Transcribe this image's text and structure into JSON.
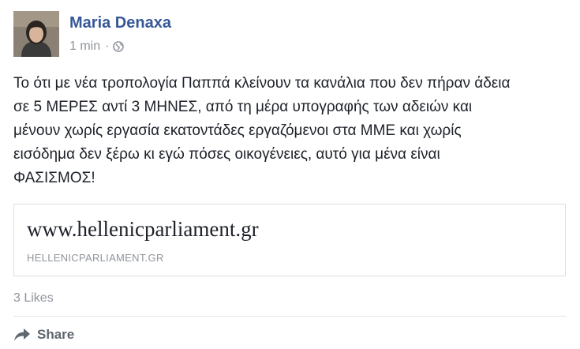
{
  "post": {
    "author": "Maria Denaxa",
    "timestamp": "1 min",
    "separator": "·",
    "audience_icon": "globe-icon",
    "text_lines": [
      "Το ότι με νέα τροπολογία Παππά κλείνουν τα κανάλια που δεν πήραν άδεια",
      "σε 5 ΜΕΡΕΣ αντί 3 ΜΗΝΕΣ, από τη μέρα υπογραφής των αδειών και",
      "μένουν χωρίς εργασία εκατοντάδες εργαζόμενοι στα ΜΜΕ και χωρίς",
      "εισόδημα δεν ξέρω κι εγώ πόσες οικογένειες, αυτό για μένα είναι",
      "ΦΑΣΙΣΜΟΣ!"
    ]
  },
  "link_preview": {
    "title": "www.hellenicparliament.gr",
    "domain": "HELLENICPARLIAMENT.GR"
  },
  "engagement": {
    "likes": "3 Likes"
  },
  "actions": {
    "share_label": "Share",
    "share_icon": "share-arrow-icon"
  },
  "colors": {
    "author_link": "#365899",
    "meta_text": "#90949c",
    "body_text": "#1d2129",
    "card_border": "#dddfe2"
  }
}
